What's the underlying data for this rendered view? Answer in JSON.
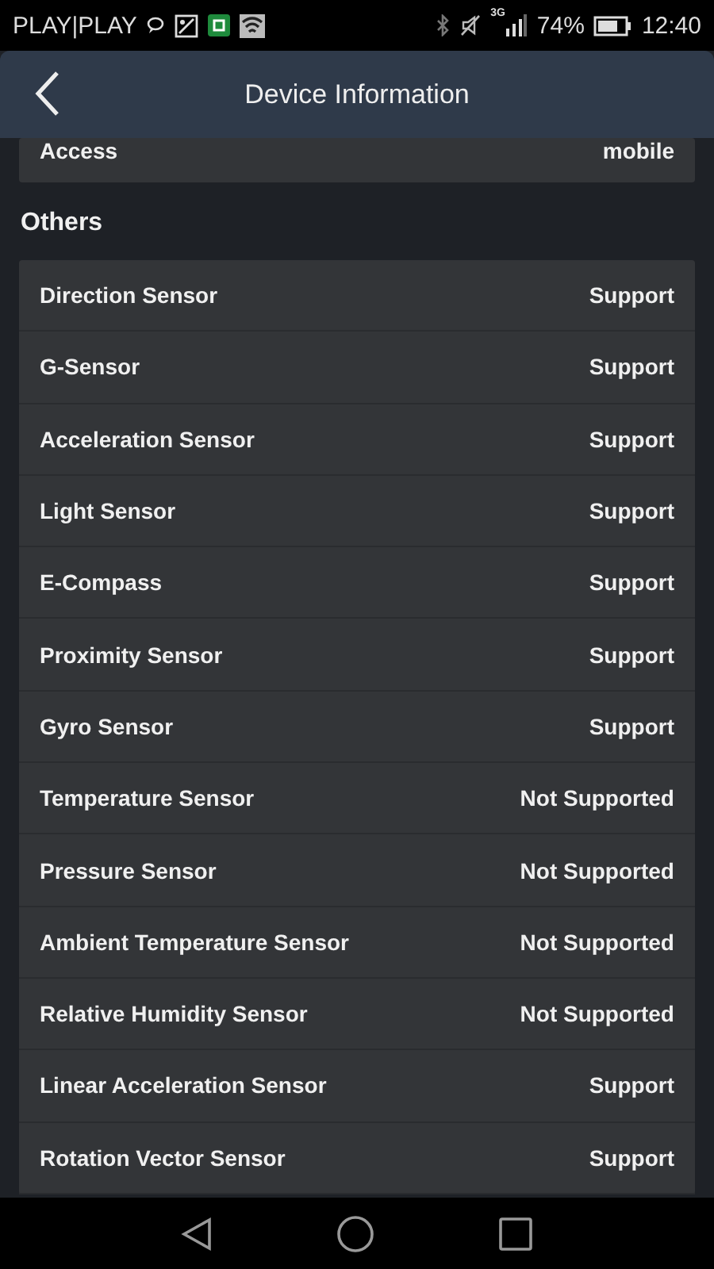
{
  "status_bar": {
    "carrier": "PLAY|PLAY",
    "battery": "74%",
    "time": "12:40",
    "network": "3G"
  },
  "header": {
    "title": "Device Information"
  },
  "top_card": {
    "label": "Access",
    "value": "mobile"
  },
  "section": {
    "title": "Others",
    "rows": [
      {
        "label": "Direction Sensor",
        "value": "Support"
      },
      {
        "label": "G-Sensor",
        "value": "Support"
      },
      {
        "label": "Acceleration Sensor",
        "value": "Support"
      },
      {
        "label": "Light Sensor",
        "value": "Support"
      },
      {
        "label": "E-Compass",
        "value": "Support"
      },
      {
        "label": "Proximity Sensor",
        "value": "Support"
      },
      {
        "label": "Gyro Sensor",
        "value": "Support"
      },
      {
        "label": "Temperature Sensor",
        "value": "Not Supported"
      },
      {
        "label": "Pressure Sensor",
        "value": "Not Supported"
      },
      {
        "label": "Ambient Temperature Sensor",
        "value": "Not Supported"
      },
      {
        "label": "Relative Humidity Sensor",
        "value": "Not Supported"
      },
      {
        "label": "Linear Acceleration Sensor",
        "value": "Support"
      },
      {
        "label": "Rotation Vector Sensor",
        "value": "Support"
      }
    ]
  }
}
